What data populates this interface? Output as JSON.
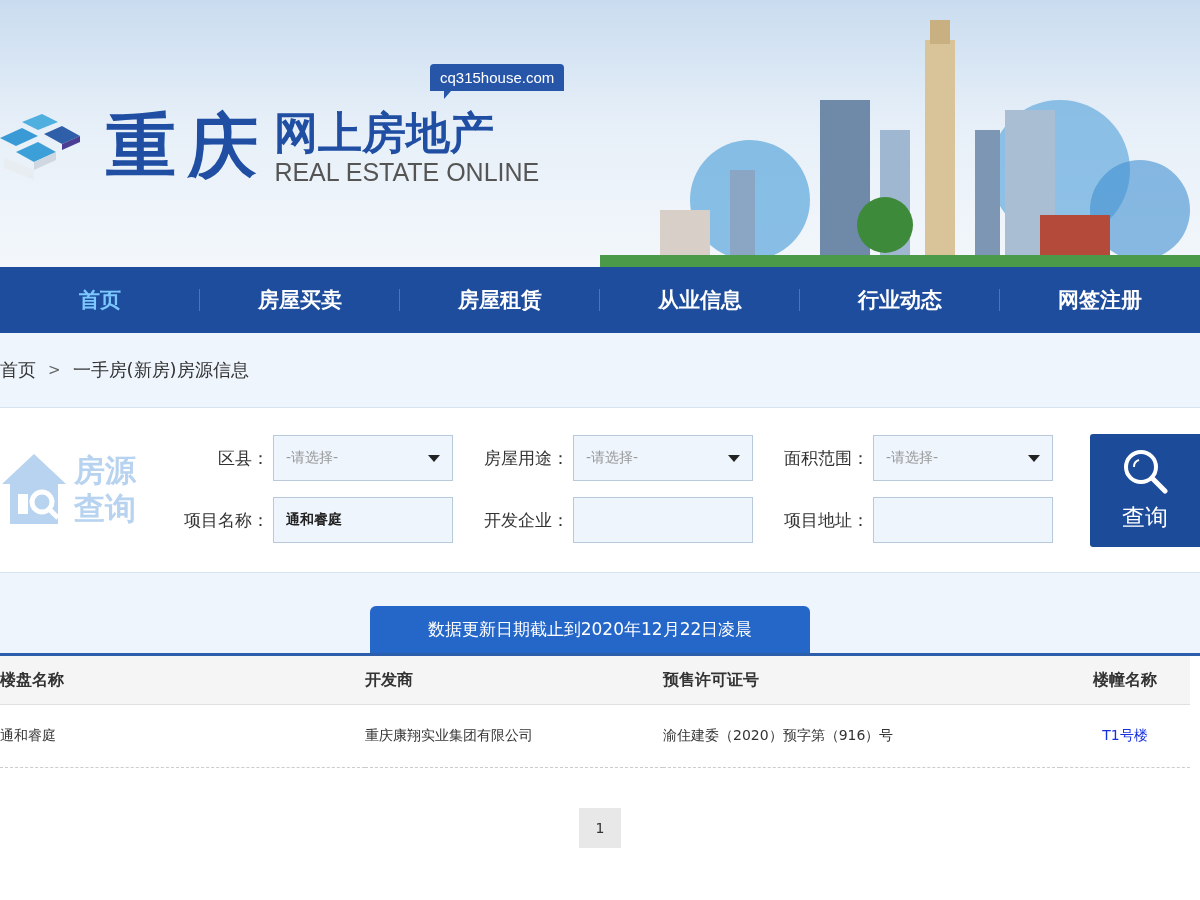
{
  "header": {
    "url_badge": "cq315house.com",
    "logo_city": "重 庆",
    "logo_title": "网上房地产",
    "logo_subtitle": "REAL ESTATE ONLINE"
  },
  "nav": {
    "items": [
      {
        "label": "首页",
        "selected": true
      },
      {
        "label": "房屋买卖",
        "selected": false
      },
      {
        "label": "房屋租赁",
        "selected": false
      },
      {
        "label": "从业信息",
        "selected": false
      },
      {
        "label": "行业动态",
        "selected": false
      },
      {
        "label": "网签注册",
        "selected": false
      }
    ]
  },
  "breadcrumb": {
    "items": [
      "首页",
      "一手房(新房)房源信息"
    ],
    "separator": ">"
  },
  "search": {
    "badge_lines": [
      "房源",
      "查询"
    ],
    "fields": [
      {
        "label": "区县：",
        "kind": "select",
        "placeholder": "-请选择-"
      },
      {
        "label": "房屋用途：",
        "kind": "select",
        "placeholder": "-请选择-"
      },
      {
        "label": "面积范围：",
        "kind": "select",
        "placeholder": "-请选择-"
      },
      {
        "label": "项目名称：",
        "kind": "text",
        "value": "通和睿庭"
      },
      {
        "label": "开发企业：",
        "kind": "text"
      },
      {
        "label": "项目地址：",
        "kind": "text"
      }
    ],
    "button": "查询"
  },
  "notice": "数据更新日期截止到2020年12月22日凌晨",
  "table": {
    "columns": [
      {
        "label": "楼盘名称",
        "kind": "text"
      },
      {
        "label": "开发商",
        "kind": "text"
      },
      {
        "label": "预售许可证号",
        "kind": "text"
      },
      {
        "label": "楼幢名称",
        "kind": "link"
      }
    ],
    "rows": [
      {
        "cells": [
          "通和睿庭",
          "重庆康翔实业集团有限公司",
          "渝住建委（2020）预字第（916）号",
          "T1号楼"
        ]
      }
    ]
  },
  "pagination": {
    "pages": [
      {
        "label": "1",
        "selected": true
      }
    ]
  }
}
